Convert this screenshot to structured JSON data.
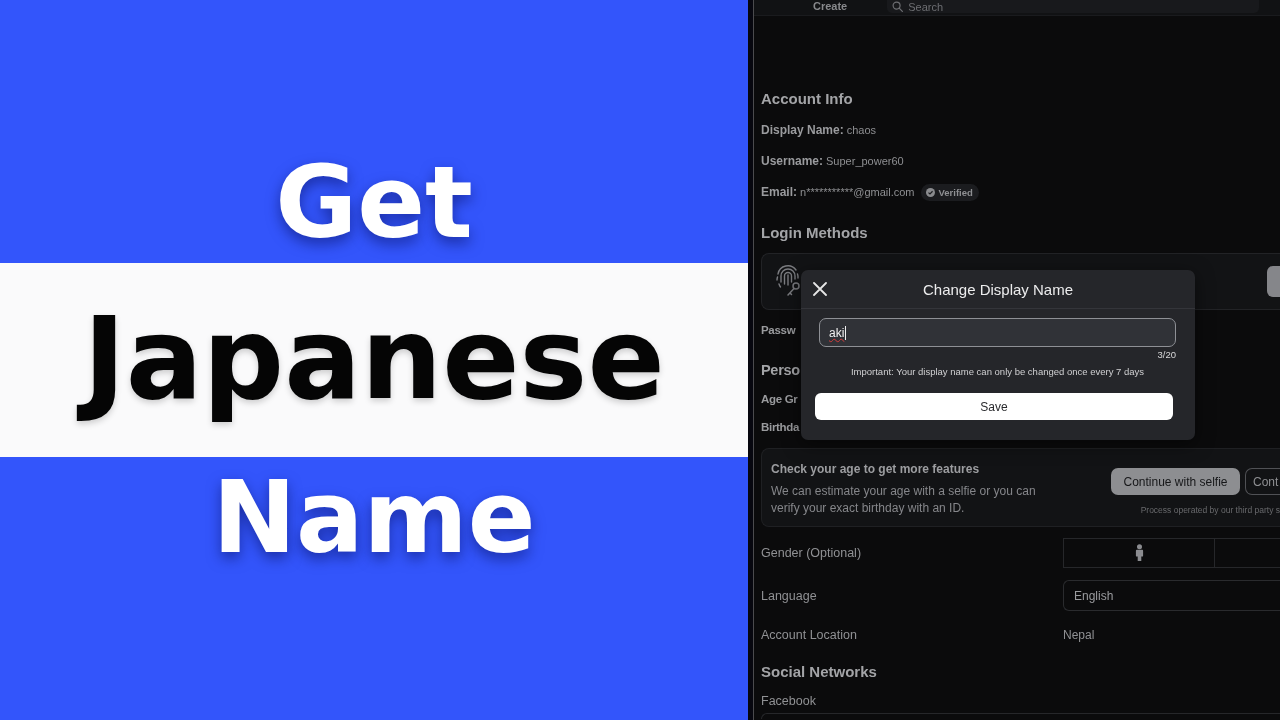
{
  "banner": {
    "lines": [
      {
        "text": "Get",
        "kind": "plain"
      },
      {
        "text": "Japanese",
        "kind": "highlight"
      },
      {
        "text": "Name",
        "kind": "plain"
      }
    ]
  },
  "app": {
    "top_bar": {
      "nav_item": "Create",
      "search": {
        "placeholder": "Search"
      }
    },
    "account_info": {
      "heading": "Account Info",
      "fields": [
        {
          "label": "Display Name:",
          "value": "chaos"
        },
        {
          "label": "Username:",
          "value": "Super_power60"
        },
        {
          "label": "Email:",
          "value": "n***********@gmail.com",
          "badge": "Verified"
        }
      ]
    },
    "login_methods": {
      "heading": "Login Methods"
    },
    "covered_labels": [
      {
        "text": "Passw",
        "kind": "label"
      },
      {
        "text": "Perso",
        "kind": "heading"
      },
      {
        "text": "Age Gr",
        "kind": "label"
      },
      {
        "text": "Birthda",
        "kind": "label"
      }
    ],
    "age_check": {
      "title": "Check your age to get more features",
      "text": "We can estimate your age with a selfie or you can verify your exact birthday with an ID.",
      "buttons": [
        {
          "label": "Continue with selfie",
          "kind": "filled"
        },
        {
          "label": "Cont",
          "kind": "outline"
        }
      ],
      "note": "Process operated by our third party s"
    },
    "settings": [
      {
        "label": "Gender (Optional)",
        "kind": "segmented"
      },
      {
        "label": "Language",
        "kind": "select",
        "value": "English"
      },
      {
        "label": "Account Location",
        "kind": "text",
        "value": "Nepal"
      }
    ],
    "social_networks": {
      "heading": "Social Networks",
      "fields": [
        {
          "label": "Facebook"
        }
      ]
    },
    "dialog": {
      "title": "Change Display Name",
      "value": "aki",
      "counter": "3/20",
      "notice": "Important: Your display name can only be changed once every 7 days",
      "button": "Save"
    }
  }
}
